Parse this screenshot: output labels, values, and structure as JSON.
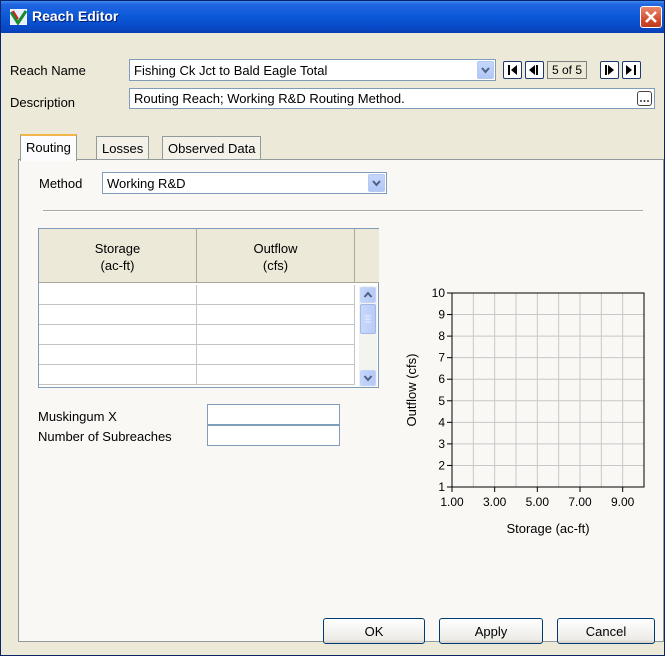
{
  "window": {
    "title": "Reach Editor"
  },
  "reach": {
    "name_label": "Reach Name",
    "name_value": "Fishing Ck Jct to Bald Eagle Total",
    "position": "5 of 5",
    "description_label": "Description",
    "description_value": "Routing Reach; Working R&D Routing Method."
  },
  "tabs": [
    {
      "label": "Routing",
      "active": true
    },
    {
      "label": "Losses",
      "active": false
    },
    {
      "label": "Observed Data",
      "active": false
    }
  ],
  "routing": {
    "method_label": "Method",
    "method_value": "Working R&D",
    "table": {
      "columns": [
        {
          "line1": "Storage",
          "line2": "(ac-ft)"
        },
        {
          "line1": "Outflow",
          "line2": "(cfs)"
        }
      ],
      "rows": [
        [
          "",
          ""
        ],
        [
          "",
          ""
        ],
        [
          "",
          ""
        ],
        [
          "",
          ""
        ],
        [
          "",
          ""
        ]
      ]
    },
    "muskingum_label": "Muskingum X",
    "muskingum_value": "",
    "subreaches_label": "Number of Subreaches",
    "subreaches_value": ""
  },
  "chart_data": {
    "type": "line",
    "series": [],
    "xlabel": "Storage (ac-ft)",
    "ylabel": "Outflow (cfs)",
    "xlim": [
      1,
      10
    ],
    "ylim": [
      1,
      10
    ],
    "xticks": [
      "1.00",
      "3.00",
      "5.00",
      "7.00",
      "9.00"
    ],
    "yticks": [
      "1",
      "2",
      "3",
      "4",
      "5",
      "6",
      "7",
      "8",
      "9",
      "10"
    ],
    "grid": true
  },
  "buttons": {
    "ok": "OK",
    "apply": "Apply",
    "cancel": "Cancel"
  },
  "colors": {
    "titlebar": "#0a58d8",
    "close": "#d4502f",
    "tab_highlight": "#f2b64a"
  },
  "icons": {
    "app": "reach-editor-icon",
    "close": "close-icon",
    "dropdown": "chevron-down-icon",
    "first": "first-record-icon",
    "prev": "previous-record-icon",
    "next": "next-record-icon",
    "last": "last-record-icon",
    "ellipsis": "ellipsis-icon"
  }
}
